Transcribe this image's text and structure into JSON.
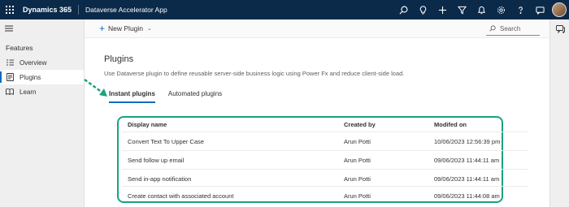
{
  "topbar": {
    "brand": "Dynamics 365",
    "app_name": "Dataverse Accelerator App",
    "icons": [
      "search-icon",
      "lightbulb-icon",
      "plus-icon",
      "filter-icon",
      "bell-icon",
      "settings-icon",
      "help-icon",
      "chat-icon"
    ]
  },
  "leftnav": {
    "section": "Features",
    "items": [
      {
        "label": "Overview",
        "icon": "overview-icon",
        "active": false
      },
      {
        "label": "Plugins",
        "icon": "plugins-icon",
        "active": true
      },
      {
        "label": "Learn",
        "icon": "book-icon",
        "active": false
      }
    ]
  },
  "commandbar": {
    "new_plugin": "New Plugin",
    "search_placeholder": "Search"
  },
  "main": {
    "title": "Plugins",
    "description": "Use Dataverse plugin to define reusable server-side business logic using Power Fx and reduce client-side load.",
    "tabs": [
      {
        "label": "Instant plugins",
        "active": true
      },
      {
        "label": "Automated plugins",
        "active": false
      }
    ]
  },
  "table": {
    "headers": [
      "Display name",
      "Created by",
      "Modifed on"
    ],
    "rows": [
      [
        "Convert Text To Upper Case",
        "Arun Potti",
        "10/06/2023 12:56:39 pm"
      ],
      [
        "Send follow up email",
        "Arun Potti",
        "09/06/2023 11:44:11 am"
      ],
      [
        "Send in-app notification",
        "Arun Potti",
        "09/06/2023 11:44:11 am"
      ],
      [
        "Create contact with associated account",
        "Arun Potti",
        "09/06/2023 11:44:08 am"
      ]
    ]
  },
  "colors": {
    "topbar_bg": "#0b2a4a",
    "accent": "#0f6cbd",
    "annotation": "#19a37e"
  }
}
